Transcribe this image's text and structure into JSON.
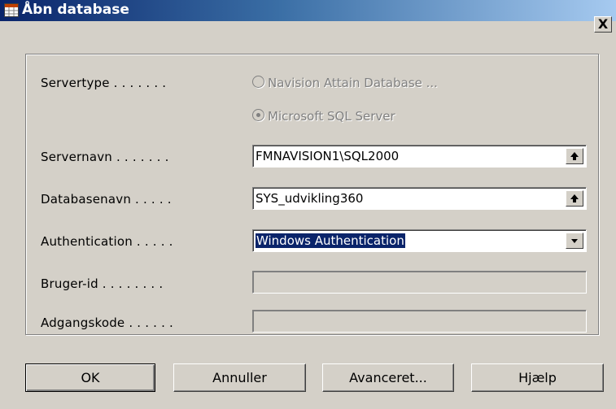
{
  "window": {
    "title": "Åbn database",
    "close_label": "X"
  },
  "form": {
    "servertype_label": "Servertype . . . . . . .",
    "servertype_options": [
      {
        "label": "Navision Attain Database ...",
        "selected": false
      },
      {
        "label": "Microsoft SQL Server",
        "selected": true
      }
    ],
    "servername_label": "Servernavn . . . . . . .",
    "servername_value": "FMNAVISION1\\SQL2000",
    "databasename_label": "Databasenavn . . . . .",
    "databasename_value": "SYS_udvikling360",
    "authentication_label": "Authentication . . . . .",
    "authentication_value": "Windows Authentication",
    "userid_label": "Bruger-id . . . . . . . .",
    "userid_value": "",
    "password_label": "Adgangskode . . . . . .",
    "password_value": ""
  },
  "buttons": {
    "ok": "OK",
    "cancel": "Annuller",
    "advanced": "Avanceret...",
    "help": "Hjælp"
  },
  "colors": {
    "titlebar_start": "#0a246a",
    "titlebar_end": "#a6caf0",
    "dialog_bg": "#d4d0c8"
  },
  "icons": {
    "title": "database-table-icon",
    "lookup": "arrow-up-icon",
    "dropdown": "chevron-down-icon"
  }
}
